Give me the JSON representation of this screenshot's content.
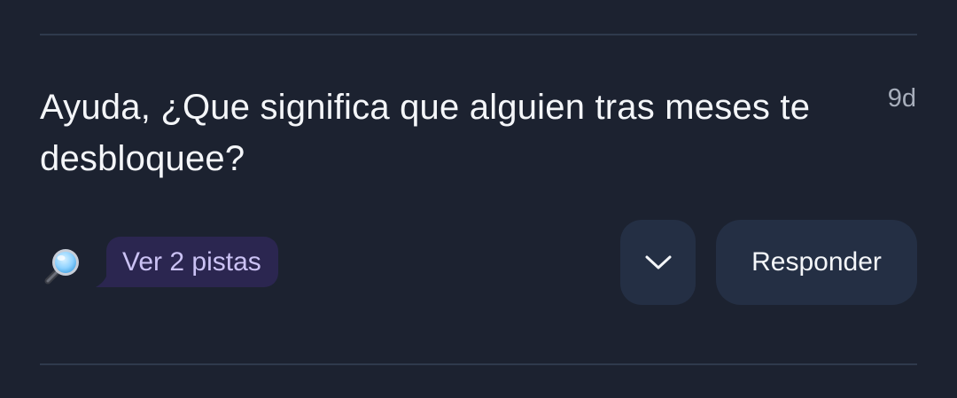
{
  "post": {
    "question": "Ayuda, ¿Que significa que alguien tras meses te desbloquee?",
    "age": "9d"
  },
  "hints": {
    "icon": "magnifier-icon",
    "label": "Ver 2 pistas"
  },
  "actions": {
    "expand_icon": "chevron-down-icon",
    "reply_label": "Responder"
  },
  "colors": {
    "background": "#1c2230",
    "divider": "#2f3a4c",
    "button": "#242f44",
    "hints_bubble": "#2b2650",
    "hints_text": "#cbc2f4",
    "text": "#f4f6f9",
    "muted": "#a7aebb"
  }
}
